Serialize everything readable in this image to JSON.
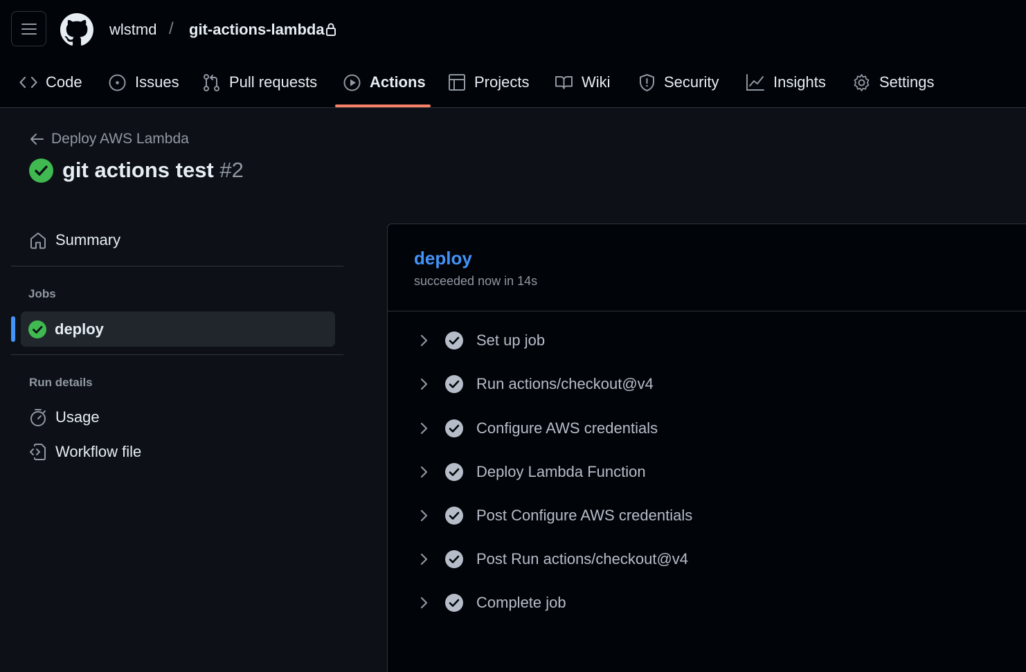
{
  "header": {
    "owner": "wlstmd",
    "separator": "/",
    "repo": "git-actions-lambda"
  },
  "tabs": [
    {
      "label": "Code",
      "icon": "code-icon"
    },
    {
      "label": "Issues",
      "icon": "issue-icon"
    },
    {
      "label": "Pull requests",
      "icon": "pull-request-icon"
    },
    {
      "label": "Actions",
      "icon": "play-icon",
      "active": true
    },
    {
      "label": "Projects",
      "icon": "table-icon"
    },
    {
      "label": "Wiki",
      "icon": "book-icon"
    },
    {
      "label": "Security",
      "icon": "shield-icon"
    },
    {
      "label": "Insights",
      "icon": "graph-icon"
    },
    {
      "label": "Settings",
      "icon": "gear-icon"
    }
  ],
  "run": {
    "workflow": "Deploy AWS Lambda",
    "title": "git actions test",
    "number": "#2"
  },
  "sidebar": {
    "summary": "Summary",
    "jobs_label": "Jobs",
    "job": "deploy",
    "run_details_label": "Run details",
    "usage": "Usage",
    "workflow_file": "Workflow file"
  },
  "job": {
    "name": "deploy",
    "status": "succeeded now in 14s"
  },
  "steps": [
    "Set up job",
    "Run actions/checkout@v4",
    "Configure AWS credentials",
    "Deploy Lambda Function",
    "Post Configure AWS credentials",
    "Post Run actions/checkout@v4",
    "Complete job"
  ],
  "colors": {
    "accent": "#4493f8",
    "success": "#3fb950",
    "active_tab": "#f78166"
  }
}
